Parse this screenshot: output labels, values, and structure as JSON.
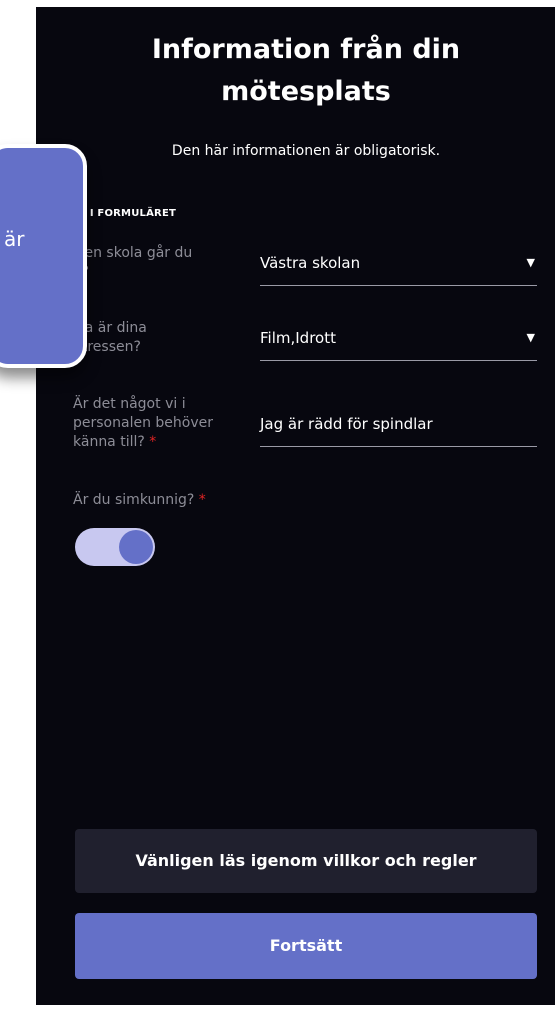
{
  "header": {
    "title_line1": "Information från din",
    "title_line2": "mötesplats",
    "subtitle": "Den här informationen är obligatorisk."
  },
  "form": {
    "section_label": "LL I FORMULÄRET",
    "school": {
      "label_line1": "lken skola går du",
      "label_line2": "å?",
      "value": "Västra skolan",
      "arrow": "▼"
    },
    "interests": {
      "label_line1": "lka är dina",
      "label_line2": "ntressen?",
      "value": "Film,Idrott",
      "arrow": "▼"
    },
    "staff_info": {
      "label_line1": "Är det något vi i",
      "label_line2": "personalen behöver",
      "label_line3": "känna till?",
      "required_mark": "*",
      "value": "Jag är rädd för spindlar"
    },
    "swimming": {
      "label": "Är du simkunnig?",
      "required_mark": "*",
      "toggle_on": true
    }
  },
  "buttons": {
    "terms_label": "Vänligen läs igenom villkor och regler",
    "continue_label": "Fortsätt"
  },
  "tooltip": {
    "text": "är"
  },
  "colors": {
    "background": "#07070f",
    "accent": "#6470c8",
    "toggle_track": "#c8c8f0",
    "required": "#e02424",
    "secondary_button": "#20202e"
  }
}
